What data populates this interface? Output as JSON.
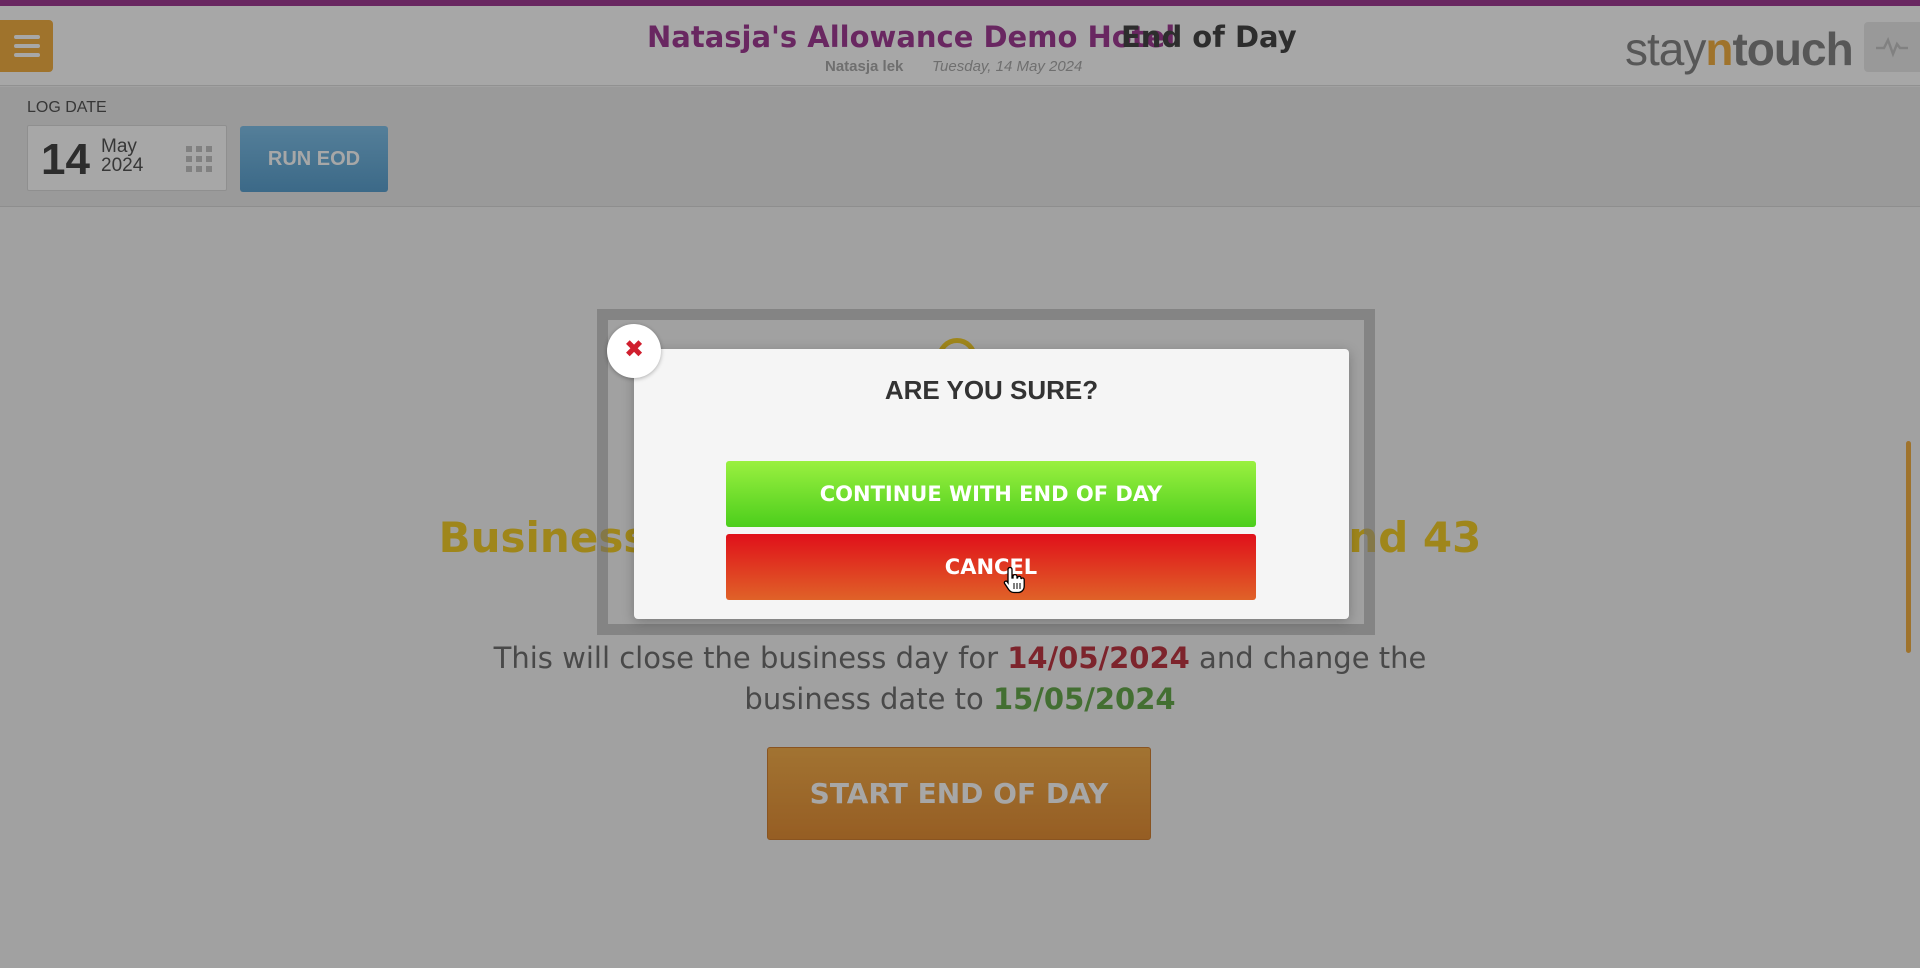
{
  "header": {
    "hotel_name": "Natasja's Allowance Demo Hotel",
    "page_title": "End of Day",
    "user_name": "Natasja lek",
    "date": "Tuesday, 14 May 2024",
    "logo": {
      "part1": "stay",
      "part2": "n",
      "part3": "touch"
    },
    "menu_icon": "hamburger-icon",
    "pulse_icon": "activity-icon"
  },
  "logbar": {
    "label": "LOG DATE",
    "day": "14",
    "month": "May",
    "year": "2024",
    "calendar_icon": "calendar-grid-icon",
    "run_button": "RUN EOD"
  },
  "content": {
    "heading_left": "Business",
    "heading_right": "nd 43",
    "desc_before": "This will close the business day for ",
    "old_date": "14/05/2024",
    "desc_middle": " and change the business date to ",
    "new_date": "15/05/2024",
    "start_button": "START END OF DAY"
  },
  "modal": {
    "title": "ARE YOU SURE?",
    "continue_button": "CONTINUE WITH END OF DAY",
    "cancel_button": "CANCEL",
    "close_icon": "close-icon",
    "close_glyph": "✖"
  },
  "colors": {
    "brand_purple": "#8f1680",
    "accent_orange": "#f0a020",
    "continue_green": "#5ad424",
    "cancel_red": "#e0101a",
    "run_blue": "#4a9ed6",
    "heading_yellow": "#f0c400"
  }
}
